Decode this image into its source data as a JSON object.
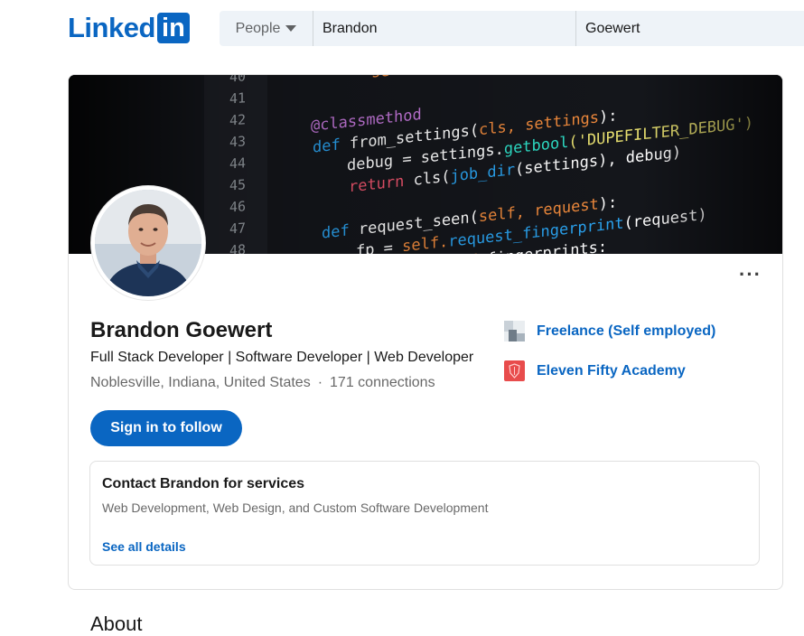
{
  "header": {
    "logo_text": "Linked",
    "logo_box": "in",
    "search": {
      "category": "People",
      "first_name": "Brandon",
      "last_name": "Goewert"
    }
  },
  "profile": {
    "name": "Brandon Goewert",
    "headline": "Full Stack Developer | Software Developer | Web Developer",
    "location": "Noblesville, Indiana, United States",
    "separator": "·",
    "connections": "171 connections",
    "follow_label": "Sign in to follow",
    "more_label": "···"
  },
  "experience": [
    {
      "label": "Freelance (Self employed)",
      "logo_icon": "freelance-logo-icon"
    },
    {
      "label": "Eleven Fifty Academy",
      "logo_icon": "eleven-fifty-shield-icon"
    }
  ],
  "services": {
    "title": "Contact Brandon for services",
    "description": "Web Development, Web Design, and Custom Software Development",
    "link": "See all details"
  },
  "about": {
    "heading": "About"
  },
  "colors": {
    "brand": "#0a66c2",
    "search_bg": "#eef3f8",
    "muted_text": "#666666"
  }
}
